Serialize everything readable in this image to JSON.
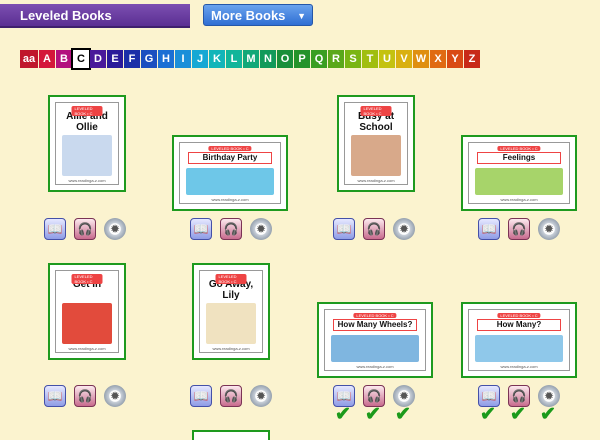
{
  "header": {
    "title": "Leveled Books",
    "more_books_label": "More Books",
    "more_caret": "▼"
  },
  "letters": [
    {
      "label": "aa",
      "color": "#c0172c"
    },
    {
      "label": "A",
      "color": "#d4173a"
    },
    {
      "label": "B",
      "color": "#b3107e"
    },
    {
      "label": "C",
      "color": "#7d1a9a",
      "selected": true
    },
    {
      "label": "D",
      "color": "#4a1a9a"
    },
    {
      "label": "E",
      "color": "#2a1a9a"
    },
    {
      "label": "F",
      "color": "#1b2fa8"
    },
    {
      "label": "G",
      "color": "#1b4fc0"
    },
    {
      "label": "H",
      "color": "#1b6fd4"
    },
    {
      "label": "I",
      "color": "#1b8fd9"
    },
    {
      "label": "J",
      "color": "#16a8d4"
    },
    {
      "label": "K",
      "color": "#12b5b9"
    },
    {
      "label": "L",
      "color": "#12b59a"
    },
    {
      "label": "M",
      "color": "#12a878"
    },
    {
      "label": "N",
      "color": "#129a5a"
    },
    {
      "label": "O",
      "color": "#1a8f3a"
    },
    {
      "label": "P",
      "color": "#24932a"
    },
    {
      "label": "Q",
      "color": "#3a9e22"
    },
    {
      "label": "R",
      "color": "#5aa81a"
    },
    {
      "label": "S",
      "color": "#7ab514"
    },
    {
      "label": "T",
      "color": "#a0be10"
    },
    {
      "label": "U",
      "color": "#c4c210"
    },
    {
      "label": "V",
      "color": "#d9b010"
    },
    {
      "label": "W",
      "color": "#df8f10"
    },
    {
      "label": "X",
      "color": "#e06a12"
    },
    {
      "label": "Y",
      "color": "#d94a14"
    },
    {
      "label": "Z",
      "color": "#c82a18"
    }
  ],
  "books": [
    {
      "title": "Allie and Ollie",
      "tag": "LEVELED BOOK • C",
      "footer": "www.readinga-z.com",
      "art_color": "#c9d9ee",
      "completed": [
        false,
        false,
        false
      ]
    },
    {
      "title": "Birthday Party",
      "tag": "LEVELED BOOK • C",
      "footer": "www.readinga-z.com",
      "art_color": "#6ec7e8",
      "completed": [
        false,
        false,
        false
      ]
    },
    {
      "title": "Busy at School",
      "tag": "LEVELED BOOK • C",
      "footer": "www.readinga-z.com",
      "art_color": "#d8a98a",
      "completed": [
        false,
        false,
        false
      ]
    },
    {
      "title": "Feelings",
      "tag": "LEVELED BOOK • C",
      "footer": "www.readinga-z.com",
      "art_color": "#a7d46a",
      "completed": [
        false,
        false,
        false
      ]
    },
    {
      "title": "Get In",
      "tag": "LEVELED BOOK • C",
      "footer": "www.readinga-z.com",
      "art_color": "#e24b3c",
      "completed": [
        false,
        false,
        false
      ]
    },
    {
      "title": "Go Away, Lily",
      "tag": "LEVELED BOOK • C",
      "footer": "www.readinga-z.com",
      "art_color": "#f0e2c0",
      "completed": [
        false,
        false,
        false
      ]
    },
    {
      "title": "How Many Wheels?",
      "tag": "LEVELED BOOK • C",
      "footer": "www.readinga-z.com",
      "art_color": "#7fb6e0",
      "completed": [
        true,
        true,
        true
      ]
    },
    {
      "title": "How Many?",
      "tag": "LEVELED BOOK • C",
      "footer": "www.readinga-z.com",
      "art_color": "#8fc8ea",
      "completed": [
        true,
        true,
        true
      ]
    }
  ],
  "icons": {
    "read": "read-book-icon",
    "listen": "listen-book-icon",
    "quiz": "quiz-icon",
    "check": "✔"
  },
  "colors": {
    "background": "#fbf3cf",
    "book_border": "#1e9a1e",
    "header": "#5b2f93",
    "button": "#2f6ed3"
  }
}
